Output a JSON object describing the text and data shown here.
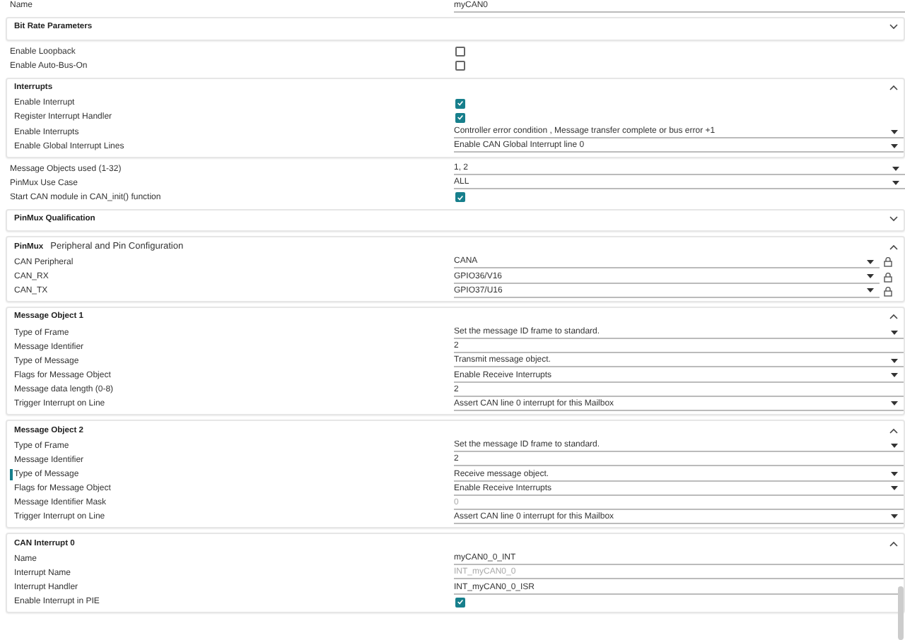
{
  "items": [
    {
      "kind": "text",
      "label": "Name",
      "value": "myCAN0",
      "disabled": false
    },
    {
      "kind": "section",
      "title": "Bit Rate Parameters",
      "expanded": false
    },
    {
      "kind": "checkbox",
      "label": "Enable Loopback",
      "checked": false
    },
    {
      "kind": "checkbox",
      "label": "Enable Auto-Bus-On",
      "checked": false
    },
    {
      "kind": "section",
      "title": "Interrupts",
      "expanded": true,
      "fields": [
        {
          "kind": "checkbox",
          "label": "Enable Interrupt",
          "checked": true
        },
        {
          "kind": "checkbox",
          "label": "Register Interrupt Handler",
          "checked": true
        },
        {
          "kind": "dropdown",
          "label": "Enable Interrupts",
          "value": "Controller error condition , Message transfer complete or bus error +1"
        },
        {
          "kind": "dropdown",
          "label": "Enable Global Interrupt Lines",
          "value": "Enable CAN Global Interrupt line 0"
        }
      ]
    },
    {
      "kind": "dropdown",
      "label": "Message Objects used (1-32)",
      "value": "1, 2"
    },
    {
      "kind": "dropdown",
      "label": "PinMux Use Case",
      "value": "ALL"
    },
    {
      "kind": "checkbox",
      "label": "Start CAN module in CAN_init() function",
      "checked": true
    },
    {
      "kind": "section",
      "title": "PinMux Qualification",
      "expanded": false
    },
    {
      "kind": "section",
      "title": "PinMux",
      "subtitle": "Peripheral and Pin Configuration",
      "expanded": true,
      "fields": [
        {
          "kind": "dropdown",
          "label": "CAN Peripheral",
          "value": "CANA",
          "locked": true
        },
        {
          "kind": "dropdown",
          "label": "CAN_RX",
          "value": "GPIO36/V16",
          "locked": true
        },
        {
          "kind": "dropdown",
          "label": "CAN_TX",
          "value": "GPIO37/U16",
          "locked": true
        }
      ]
    },
    {
      "kind": "section",
      "title": "Message Object 1",
      "expanded": true,
      "fields": [
        {
          "kind": "dropdown",
          "label": "Type of Frame",
          "value": "Set the message ID frame to standard."
        },
        {
          "kind": "text",
          "label": "Message Identifier",
          "value": "2",
          "disabled": false
        },
        {
          "kind": "dropdown",
          "label": "Type of Message",
          "value": "Transmit message object."
        },
        {
          "kind": "dropdown",
          "label": "Flags for Message Object",
          "value": "Enable Receive Interrupts"
        },
        {
          "kind": "text",
          "label": "Message data length (0-8)",
          "value": "2",
          "disabled": false
        },
        {
          "kind": "dropdown",
          "label": "Trigger Interrupt on Line",
          "value": "Assert CAN line 0 interrupt for this Mailbox"
        }
      ]
    },
    {
      "kind": "section",
      "title": "Message Object 2",
      "expanded": true,
      "fields": [
        {
          "kind": "dropdown",
          "label": "Type of Frame",
          "value": "Set the message ID frame to standard.",
          "selected": false
        },
        {
          "kind": "text",
          "label": "Message Identifier",
          "value": "2",
          "disabled": false,
          "selected": false
        },
        {
          "kind": "dropdown",
          "label": "Type of Message",
          "value": "Receive message object.",
          "selected": true
        },
        {
          "kind": "dropdown",
          "label": "Flags for Message Object",
          "value": "Enable Receive Interrupts",
          "selected": false
        },
        {
          "kind": "text",
          "label": "Message Identifier Mask",
          "value": "0",
          "disabled": true,
          "selected": false
        },
        {
          "kind": "dropdown",
          "label": "Trigger Interrupt on Line",
          "value": "Assert CAN line 0 interrupt for this Mailbox",
          "selected": false
        }
      ]
    },
    {
      "kind": "section",
      "title": "CAN Interrupt 0",
      "expanded": true,
      "fields": [
        {
          "kind": "text",
          "label": "Name",
          "value": "myCAN0_0_INT",
          "disabled": false
        },
        {
          "kind": "text",
          "label": "Interrupt Name",
          "value": "INT_myCAN0_0",
          "disabled": true
        },
        {
          "kind": "text",
          "label": "Interrupt Handler",
          "value": "INT_myCAN0_0_ISR",
          "disabled": false
        },
        {
          "kind": "checkbox",
          "label": "Enable Interrupt in PIE",
          "checked": true
        }
      ]
    }
  ]
}
